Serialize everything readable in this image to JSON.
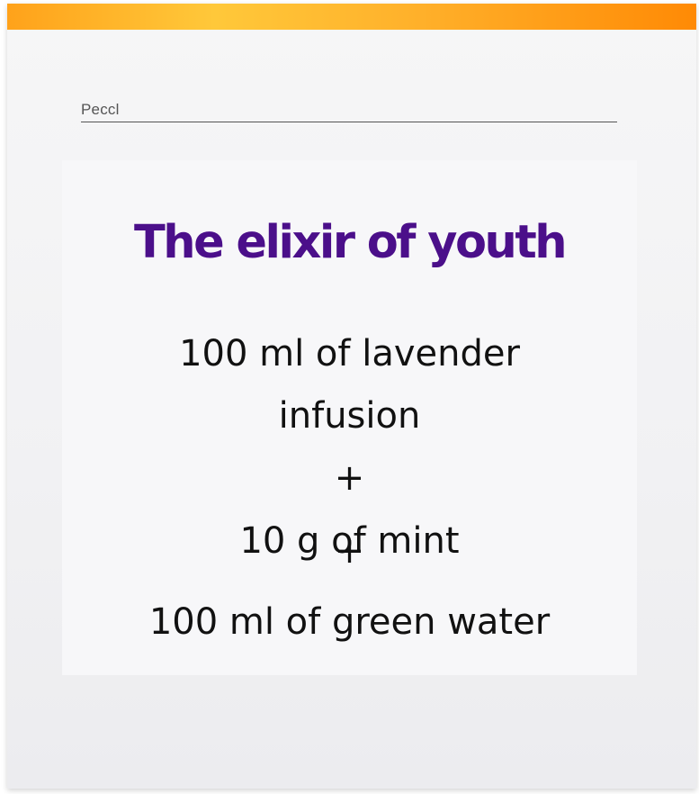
{
  "header": {
    "label": "Peccl"
  },
  "recipe": {
    "title": "The elixir of youth",
    "ingredient_1_line_1": "100 ml of lavender",
    "ingredient_1_line_2": "infusion",
    "plus_1": "+",
    "ingredient_2": "10 g of mint",
    "plus_2": "+",
    "ingredient_3": "100 ml of green water"
  },
  "colors": {
    "accent_bar": "#ff9a10",
    "title": "#4b0f8a"
  }
}
